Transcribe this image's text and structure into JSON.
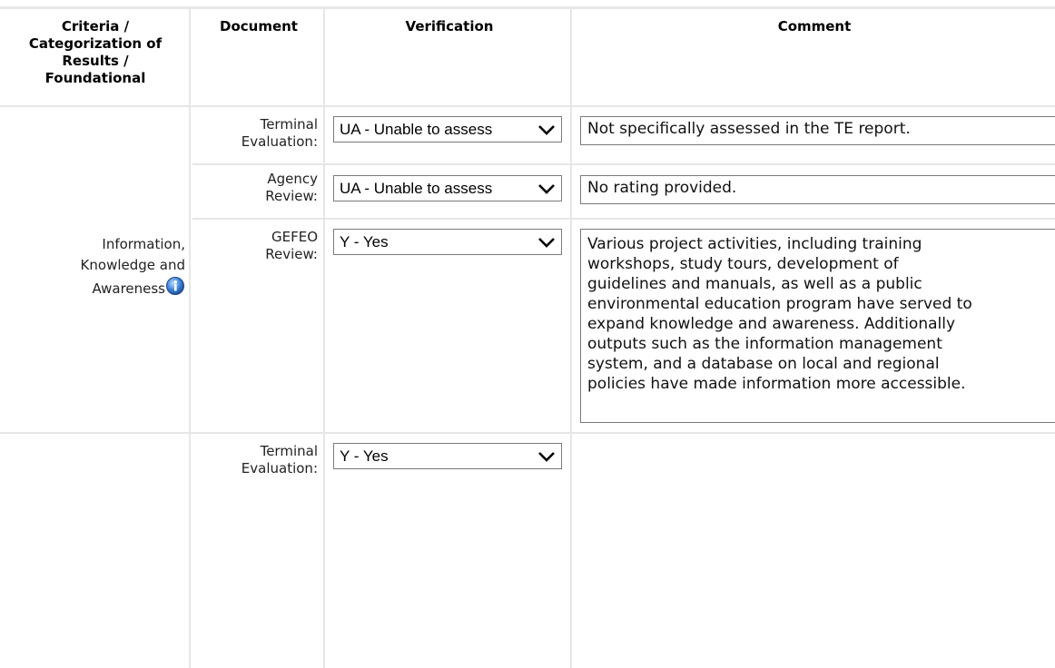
{
  "headers": {
    "criteria_lines": [
      "Criteria /",
      "Categorization of",
      "Results /",
      "Foundational"
    ],
    "document": "Document",
    "verification": "Verification",
    "comment": "Comment"
  },
  "group1": {
    "criteria_lines": [
      "Information,",
      "Knowledge and",
      "Awareness"
    ],
    "rows": [
      {
        "doc_lines": [
          "Terminal",
          "Evaluation:"
        ],
        "verification": "UA - Unable to assess",
        "comment": "Not specifically assessed in the TE report."
      },
      {
        "doc_lines": [
          "Agency",
          "Review:"
        ],
        "verification": "UA - Unable to assess",
        "comment": "No rating provided."
      },
      {
        "doc_lines": [
          "GEFEO",
          "Review:"
        ],
        "verification": "Y - Yes",
        "comment_lines": [
          "Various project activities, including training",
          "workshops, study tours, development of",
          "guidelines and manuals, as well as a public",
          "environmental education program have served to",
          "expand knowledge and awareness. Additionally",
          "outputs such as the information management",
          "system, and a database on local and regional",
          "policies have made information more accessible."
        ]
      }
    ]
  },
  "group2": {
    "rows": [
      {
        "doc_lines": [
          "Terminal",
          "Evaluation:"
        ],
        "verification": "Y - Yes"
      }
    ]
  },
  "icons": {
    "info": "info-icon",
    "dropdown": "chevron-down-icon"
  },
  "colors": {
    "grid": "#e6e6e6",
    "border": "#7a7a7a",
    "info_icon": "#2f6fc9"
  }
}
